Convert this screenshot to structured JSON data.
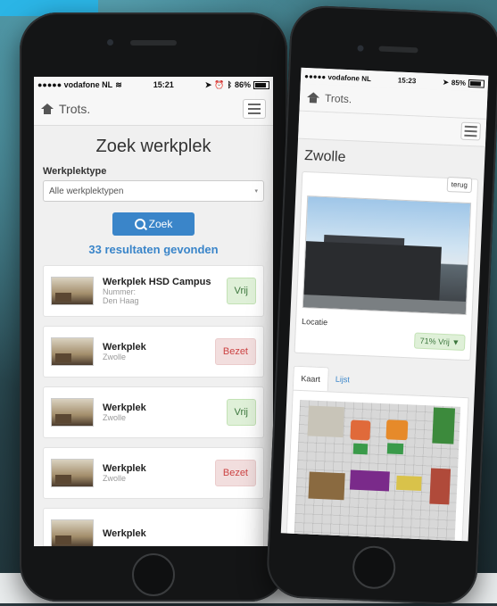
{
  "left": {
    "status": {
      "carrier": "●●●●● vodafone NL",
      "wifi": "wifi-icon",
      "time": "15:21",
      "battery": "86%"
    },
    "nav": {
      "brand": "Trots."
    },
    "title": "Zoek werkplek",
    "filter": {
      "label": "Werkplektype",
      "selected": "Alle werkplektypen"
    },
    "search_label": "Zoek",
    "results": "33 resultaten gevonden",
    "items": [
      {
        "title": "Werkplek HSD Campus",
        "line1": "Nummer:",
        "line2": "Den Haag",
        "status": "Vrij",
        "state": "free"
      },
      {
        "title": "Werkplek",
        "line1": "Zwolle",
        "line2": "",
        "status": "Bezet",
        "state": "busy"
      },
      {
        "title": "Werkplek",
        "line1": "Zwolle",
        "line2": "",
        "status": "Vrij",
        "state": "free"
      },
      {
        "title": "Werkplek",
        "line1": "Zwolle",
        "line2": "",
        "status": "Bezet",
        "state": "busy"
      },
      {
        "title": "Werkplek",
        "line1": "",
        "line2": "",
        "status": "",
        "state": "busy"
      }
    ]
  },
  "right": {
    "status": {
      "carrier": "●●●●● vodafone NL",
      "time": "15:23",
      "battery": "85%"
    },
    "nav": {
      "brand": "Trots."
    },
    "title": "Zwolle",
    "back_label": "terug",
    "location_label": "Locatie",
    "percent": "71% Vrij",
    "tabs": [
      "Kaart",
      "Lijst"
    ]
  },
  "colors": {
    "primary": "#3a85c9",
    "free_bg": "#dff0d8",
    "busy_bg": "#f2dede"
  }
}
